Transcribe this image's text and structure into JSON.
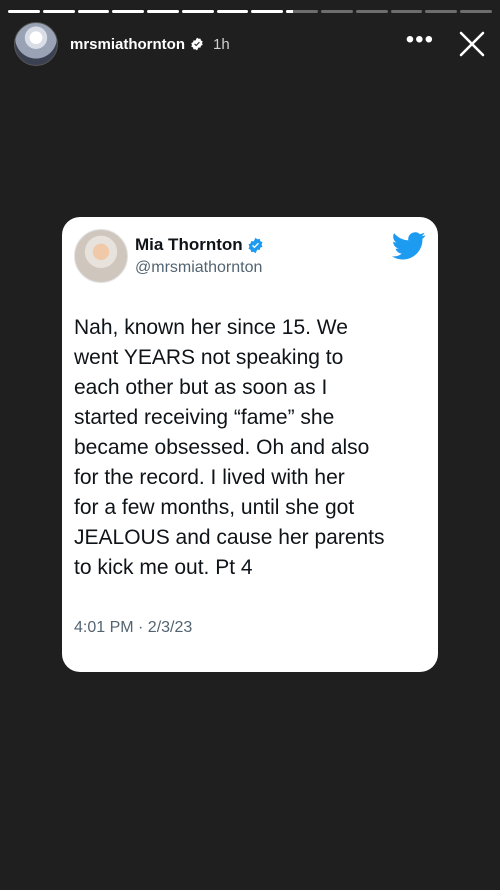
{
  "story": {
    "progress_segments": [
      1,
      1,
      1,
      1,
      1,
      1,
      1,
      1,
      0.2,
      0,
      0,
      0,
      0,
      0
    ],
    "username": "mrsmiathornton",
    "time_ago": "1h",
    "more_glyph": "•••",
    "icons": {
      "verified": "verified-badge-icon",
      "close": "close-icon",
      "more": "more-options-icon"
    }
  },
  "tweet": {
    "display_name": "Mia Thornton",
    "handle": "@mrsmiathornton",
    "text": "Nah, known her since 15. We\nwent YEARS not speaking to\neach other but as soon as I\nstarted receiving “fame” she\nbecame obsessed. Oh and also\nfor the record.  I lived with her\nfor a few months, until she got\nJEALOUS and cause her parents\nto kick me out. Pt 4",
    "timestamp": "4:01 PM · 2/3/23",
    "colors": {
      "twitter_blue": "#1d9bf0",
      "text": "#0f1419",
      "muted": "#536471"
    },
    "icons": {
      "brand": "twitter-bird-icon",
      "verified": "verified-badge-icon"
    }
  }
}
